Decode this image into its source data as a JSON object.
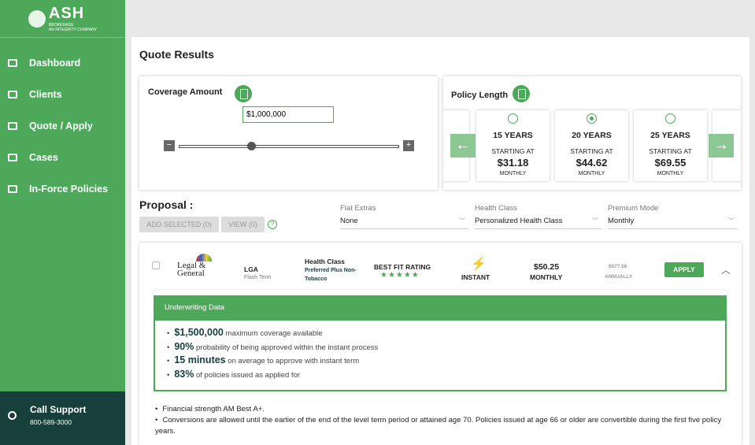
{
  "brand": {
    "name": "ASH",
    "sub": "BROKERAGE",
    "tag": "AN INTEGRITY COMPANY",
    "accent": "#4ea85a",
    "dark": "#17403c"
  },
  "nav": [
    {
      "label": "Dashboard",
      "icon": "grid-icon"
    },
    {
      "label": "Clients",
      "icon": "users-icon"
    },
    {
      "label": "Quote / Apply",
      "icon": "list-icon"
    },
    {
      "label": "Cases",
      "icon": "briefcase-icon"
    },
    {
      "label": "In-Force Policies",
      "icon": "chart-icon"
    }
  ],
  "support": {
    "label": "Call Support",
    "phone": "800-589-3000"
  },
  "page": {
    "title": "Quote Results"
  },
  "coverage": {
    "title": "Coverage Amount",
    "value": "$1,000,000",
    "minus": "−",
    "plus": "+",
    "level": 0.33
  },
  "policy": {
    "title": "Policy Length",
    "prev": "←",
    "next": "→",
    "cards": [
      {
        "years": "15 YEARS",
        "starting": "STARTING AT",
        "price": "$31.18",
        "mode": "MONTHLY",
        "selected": false
      },
      {
        "years": "20 YEARS",
        "starting": "STARTING AT",
        "price": "$44.62",
        "mode": "MONTHLY",
        "selected": true
      },
      {
        "years": "25 YEARS",
        "starting": "STARTING AT",
        "price": "$69.55",
        "mode": "MONTHLY",
        "selected": false
      }
    ]
  },
  "proposal": {
    "title": "Proposal :",
    "add_selected": "ADD SELECTED (0)",
    "view": "VIEW (0)",
    "help": "?"
  },
  "filters": [
    {
      "label": "Flat Extras",
      "value": "None"
    },
    {
      "label": "Health Class",
      "value": "Personalized Health Class"
    },
    {
      "label": "Premium Mode",
      "value": "Monthly"
    }
  ],
  "quote": {
    "carrier_logo": "Legal & General",
    "carrier": "LGA",
    "product": "Flash Term",
    "hc_label": "Health Class",
    "hc_value": "Preferred Plus Non-Tobacco",
    "rating_label": "BEST FIT RATING",
    "stars": 5,
    "stars_text": "★★★★★",
    "speed": "INSTANT",
    "monthly": "$50.25",
    "monthly_label": "MONTHLY",
    "annual": "$577.56",
    "annual_label": "ANNUALLY",
    "apply": "APPLY",
    "collapse": "︿"
  },
  "underwriting": {
    "title": "Underwriting Data",
    "items": [
      {
        "strong": "$1,500,000",
        "text": " maximum coverage available"
      },
      {
        "strong": "90%",
        "text": " probability of being approved within the instant process"
      },
      {
        "strong": "15 minutes",
        "text": " on average to approve with instant term"
      },
      {
        "strong": "83%",
        "text": " of policies issued as applied for"
      }
    ]
  },
  "notes": [
    "Financial strength AM Best A+.",
    "Conversions are allowed until the earlier of the end of the level term period or attained age 70. Policies issued at age 66 or older are convertible during the first five policy years."
  ]
}
